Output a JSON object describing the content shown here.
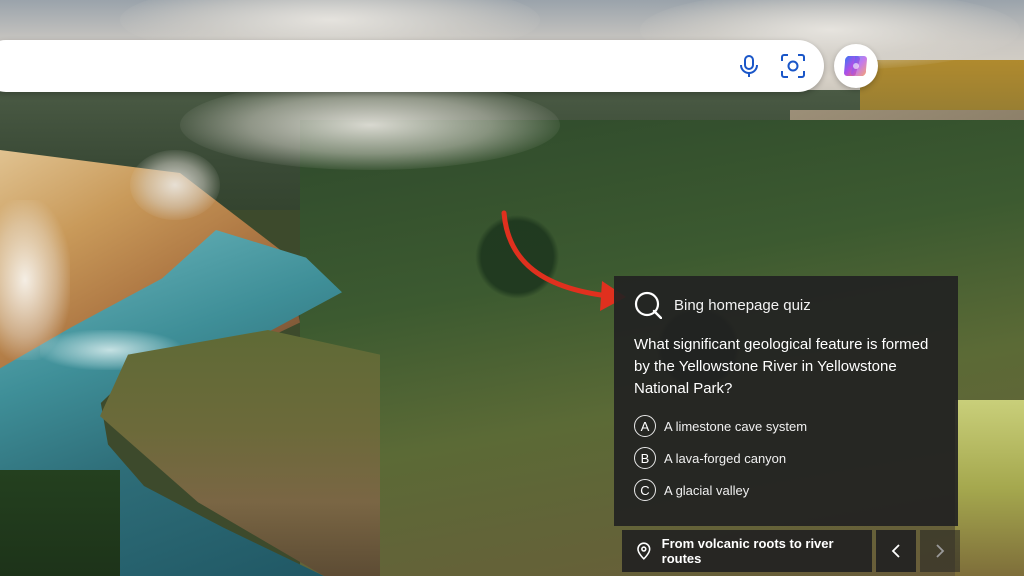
{
  "search": {
    "value": "",
    "placeholder": "",
    "icons": [
      "microphone-icon",
      "visual-search-icon"
    ]
  },
  "copilot": {
    "icon": "copilot-icon"
  },
  "quiz": {
    "title": "Bing homepage quiz",
    "question": "What significant geological feature is formed by the Yellowstone River in Yellowstone National Park?",
    "options": [
      {
        "letter": "A",
        "text": "A limestone cave system"
      },
      {
        "letter": "B",
        "text": "A lava-forged canyon"
      },
      {
        "letter": "C",
        "text": "A glacial valley"
      }
    ]
  },
  "caption": {
    "text": "From volcanic roots to river routes",
    "icon": "location-pin-icon"
  },
  "navigation": {
    "prev_icon": "chevron-left-icon",
    "next_icon": "chevron-right-icon"
  },
  "colors": {
    "annotation_arrow": "#e0301e",
    "card_background": "#222222",
    "search_background": "#ffffff"
  }
}
